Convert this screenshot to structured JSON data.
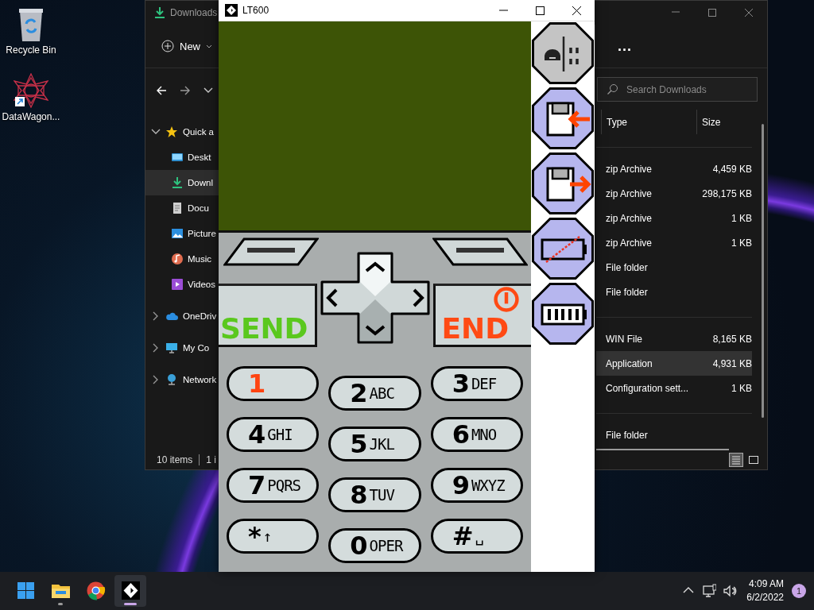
{
  "desktop_icons": [
    {
      "label": "Recycle Bin",
      "kind": "recycle-bin"
    },
    {
      "label": "DataWagon...",
      "kind": "shortcut"
    }
  ],
  "explorer": {
    "title": "Downloads",
    "new_button": "New",
    "more_button": "...",
    "search": {
      "placeholder": "Search Downloads"
    },
    "nav": [
      {
        "label": "Quick a",
        "kind": "star",
        "expanded": true,
        "selected": false,
        "children": [
          {
            "label": "Deskt",
            "kind": "desktop",
            "selected": false
          },
          {
            "label": "Downl",
            "kind": "download",
            "selected": true
          },
          {
            "label": "Docu",
            "kind": "document",
            "selected": false
          },
          {
            "label": "Picture",
            "kind": "pictures",
            "selected": false
          },
          {
            "label": "Music",
            "kind": "music",
            "selected": false
          },
          {
            "label": "Videos",
            "kind": "videos",
            "selected": false
          }
        ]
      },
      {
        "label": "OneDriv",
        "kind": "cloud",
        "expanded": false,
        "selected": false
      },
      {
        "label": "My Co",
        "kind": "pc",
        "expanded": false,
        "selected": false
      },
      {
        "label": "Network",
        "kind": "network",
        "expanded": false,
        "selected": false
      }
    ],
    "columns": [
      "Type",
      "Size"
    ],
    "row_groups": [
      {
        "rows": [
          {
            "type": "zip Archive",
            "size": "4,459 KB",
            "selected": false
          },
          {
            "type": "zip Archive",
            "size": "298,175 KB",
            "selected": false
          },
          {
            "type": "zip Archive",
            "size": "1 KB",
            "selected": false
          },
          {
            "type": "zip Archive",
            "size": "1 KB",
            "selected": false
          },
          {
            "type": "File folder",
            "selected": false
          },
          {
            "type": "File folder",
            "selected": false
          }
        ]
      },
      {
        "rows": [
          {
            "type": "WIN File",
            "size": "8,165 KB",
            "selected": false
          },
          {
            "type": "Application",
            "size": "4,931 KB",
            "selected": true
          },
          {
            "type": "Configuration sett...",
            "size": "1 KB",
            "selected": false
          }
        ]
      },
      {
        "rows": [
          {
            "type": "File folder",
            "selected": false
          }
        ]
      }
    ],
    "status": {
      "items": "10 items",
      "selection": "1 i"
    },
    "views": [
      {
        "kind": "details",
        "selected": true
      },
      {
        "kind": "tiles",
        "selected": false
      }
    ]
  },
  "emulator": {
    "title": "LT600",
    "side_buttons": [
      {
        "kind": "device"
      },
      {
        "kind": "floppy-in"
      },
      {
        "kind": "floppy-out"
      },
      {
        "kind": "battery-empty"
      },
      {
        "kind": "battery-full"
      }
    ],
    "send": "SEND",
    "end": "END",
    "keys": [
      {
        "digit": "1",
        "color": "#ff4411"
      },
      {
        "digit": "2",
        "letters": "ABC",
        "color": "#000000"
      },
      {
        "digit": "3",
        "letters": "DEF",
        "color": "#000000"
      },
      {
        "digit": "4",
        "letters": "GHI",
        "color": "#000000"
      },
      {
        "digit": "5",
        "letters": "JKL",
        "color": "#000000"
      },
      {
        "digit": "6",
        "letters": "MNO",
        "color": "#000000"
      },
      {
        "digit": "7",
        "letters": "PQRS",
        "color": "#000000"
      },
      {
        "digit": "8",
        "letters": "TUV",
        "color": "#000000"
      },
      {
        "digit": "9",
        "letters": "WXYZ",
        "color": "#000000"
      },
      {
        "digit": "*",
        "letters": "↑",
        "color": "#000000"
      },
      {
        "digit": "0",
        "letters": "OPER",
        "color": "#000000"
      },
      {
        "digit": "#",
        "letters": "␣",
        "color": "#000000"
      }
    ]
  },
  "taskbar": {
    "apps": [
      {
        "kind": "start",
        "running": false,
        "selected": false
      },
      {
        "kind": "explorer",
        "running": true,
        "selected": false
      },
      {
        "kind": "browser",
        "running": false,
        "selected": false
      },
      {
        "kind": "lt600",
        "running": true,
        "selected": true
      }
    ],
    "time": "4:09 AM",
    "date": "6/2/2022",
    "notifications": "1"
  }
}
